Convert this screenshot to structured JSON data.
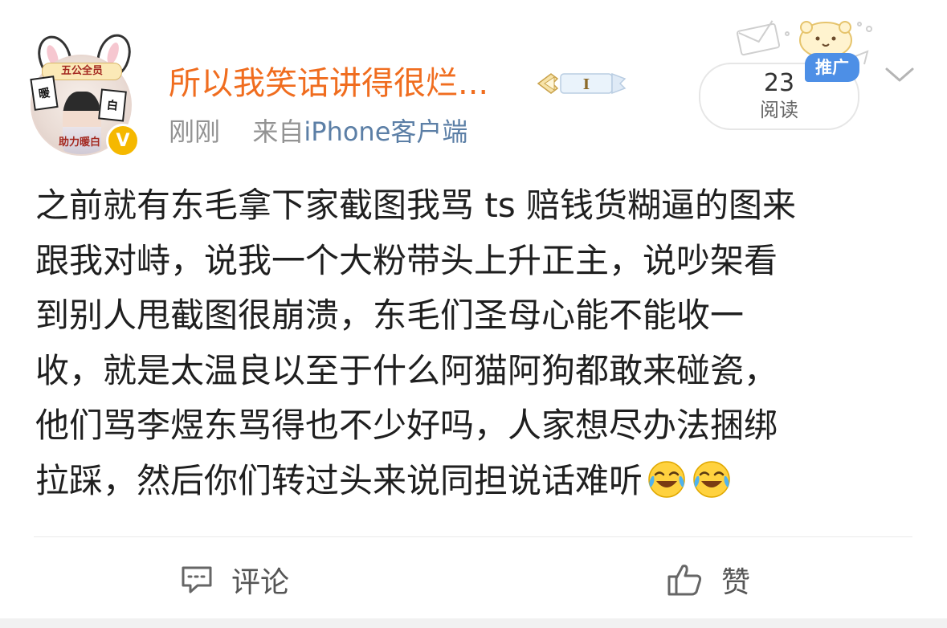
{
  "post": {
    "user": {
      "name": "所以我笑话讲得很烂...",
      "avatar_text_top": "五公全员",
      "avatar_text_bottom": "助力暖白",
      "avatar_chip_left": "暖",
      "avatar_chip_right": "白",
      "verified_badge": "V",
      "level_badge": "I"
    },
    "meta": {
      "time": "刚刚",
      "source_prefix": "来自",
      "source": "iPhone客户端"
    },
    "read": {
      "count": "23",
      "label": "阅读"
    },
    "promo_badge": "推广",
    "content_lines": [
      "之前就有东毛拿下家截图我骂 ts 赔钱货糊逼的图来",
      "跟我对峙，说我一个大粉带头上升正主，说吵架看",
      "到别人甩截图很崩溃，东毛们圣母心能不能收一",
      "收，就是太温良以至于什么阿猫阿狗都敢来碰瓷，",
      "他们骂李煜东骂得也不少好吗，人家想尽办法捆绑",
      "拉踩，然后你们转过头来说同担说话难听"
    ],
    "content_emojis": [
      "laugh-cry-icon",
      "laugh-cry-icon"
    ],
    "actions": {
      "comment_label": "评论",
      "like_label": "赞"
    }
  },
  "colors": {
    "username": "#f06d1f",
    "source_link": "#5c7fa6",
    "meta_gray": "#939393",
    "promo_blue": "#4d8fe6",
    "verified_gold": "#f5b800"
  }
}
